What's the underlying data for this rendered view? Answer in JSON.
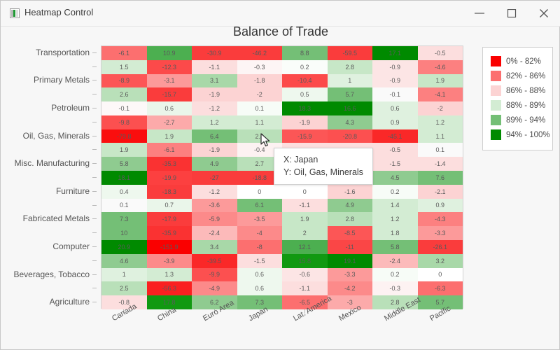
{
  "window": {
    "title": "Heatmap Control",
    "icon": "heatmap-app-icon",
    "minimize_label": "─",
    "maximize_label": "□",
    "close_label": "✕"
  },
  "chart_title": "Balance of Trade",
  "legend": {
    "items": [
      {
        "label": "0% - 82%",
        "color": "#fa0000"
      },
      {
        "label": "82% - 86%",
        "color": "#fc6f6f"
      },
      {
        "label": "86% - 88%",
        "color": "#fcd3d3"
      },
      {
        "label": "88% - 89%",
        "color": "#d3ecd3"
      },
      {
        "label": "89% - 94%",
        "color": "#74bf76"
      },
      {
        "label": "94% - 100%",
        "color": "#008a00"
      }
    ]
  },
  "tooltip": {
    "x_line": "X: Japan",
    "y_line": "Y: Oil, Gas, Minerals"
  },
  "chart_data": {
    "type": "heatmap",
    "title": "Balance of Trade",
    "xlabel": "",
    "ylabel": "",
    "grid": false,
    "legend_position": "right",
    "x_categories": [
      "Canada",
      "China",
      "Euro Area",
      "Japan",
      "Lat. America",
      "Mexico",
      "Middle East",
      "Pacific"
    ],
    "y_categories": [
      "Transportation",
      "",
      "Primary Metals",
      "",
      "Petroleum",
      "",
      "Oil, Gas, Minerals",
      "",
      "Misc. Manufacturing",
      "",
      "Furniture",
      "",
      "Fabricated Metals",
      "",
      "Computer",
      "",
      "Beverages, Tobacco",
      "",
      "Agriculture"
    ],
    "y_labeled_rows": [
      0,
      2,
      4,
      6,
      8,
      10,
      12,
      14,
      16,
      18
    ],
    "color_bins": [
      {
        "range": "0% - 82%",
        "color": "#fa0000"
      },
      {
        "range": "82% - 86%",
        "color": "#fc6f6f"
      },
      {
        "range": "86% - 88%",
        "color": "#fcd3d3"
      },
      {
        "range": "88% - 89%",
        "color": "#d3ecd3"
      },
      {
        "range": "89% - 94%",
        "color": "#74bf76"
      },
      {
        "range": "94% - 100%",
        "color": "#008a00"
      }
    ],
    "rows": [
      {
        "values": [
          -6.1,
          10.9,
          -30.9,
          -46.2,
          8.8,
          -59.5,
          17.1,
          -0.5
        ],
        "colors": [
          "#fc6f6f",
          "#4caf50",
          "#fa3c3c",
          "#fa3c3c",
          "#74bf76",
          "#fa3c3c",
          "#008a00",
          "#fcdede"
        ]
      },
      {
        "values": [
          1.5,
          -12.3,
          -1.1,
          -0.3,
          0.2,
          2.8,
          -0.9,
          -4.6
        ],
        "colors": [
          "#d3ecd3",
          "#fc4a4a",
          "#fcdede",
          "#fdf5f5",
          "#fafdfa",
          "#c7e7c7",
          "#fce5e5",
          "#fc8080"
        ]
      },
      {
        "values": [
          -8.9,
          -3.1,
          3.1,
          -1.8,
          -10.4,
          1,
          -0.9,
          1.9
        ],
        "colors": [
          "#fc5656",
          "#fc9a9a",
          "#a8d8a8",
          "#fcd3d3",
          "#fc4a4a",
          "#dff1df",
          "#fce5e5",
          "#c7e7c7"
        ]
      },
      {
        "values": [
          2.6,
          -15.7,
          -1.9,
          -2,
          0.5,
          5.7,
          -0.1,
          -4.1
        ],
        "colors": [
          "#b9e0b9",
          "#fa3c3c",
          "#fcd3d3",
          "#fcd3d3",
          "#eef8ee",
          "#74bf76",
          "#fafafa",
          "#fc8080"
        ]
      },
      {
        "values": [
          -0.1,
          0.6,
          -1.2,
          0.1,
          18.3,
          16.6,
          0.6,
          -2
        ],
        "colors": [
          "#fdf8f8",
          "#eaf6ea",
          "#fcdede",
          "#f7fcf7",
          "#008a00",
          "#008a00",
          "#dff1df",
          "#fcd3d3"
        ]
      },
      {
        "values": [
          -9.8,
          -2.7,
          1.2,
          1.1,
          -1.9,
          4.3,
          0.9,
          1.2
        ],
        "colors": [
          "#fc5050",
          "#fcaaaa",
          "#d3ecd3",
          "#d3ecd3",
          "#fcd3d3",
          "#8fcb90",
          "#dff1df",
          "#d3ecd3"
        ]
      },
      {
        "values": [
          -79.8,
          1.9,
          6.4,
          2.4,
          -15.9,
          -20.8,
          -45.1,
          1.1
        ],
        "colors": [
          "#fa0e0e",
          "#c7e7c7",
          "#74bf76",
          "#b9e0b9",
          "#fc5656",
          "#fc5050",
          "#fa2828",
          "#d3ecd3"
        ]
      },
      {
        "values": [
          1.9,
          -6.1,
          -1.9,
          -0.4,
          null,
          null,
          -0.5,
          0.1
        ],
        "colors": [
          "#c7e7c7",
          "#fc8080",
          "#fcd3d3",
          "#fdf2f2",
          "#fcdede",
          "#fcdede",
          "#fcdede",
          "#fafafa"
        ]
      },
      {
        "values": [
          5.8,
          -35.3,
          4.9,
          2.7,
          null,
          null,
          -1.5,
          -1.4
        ],
        "colors": [
          "#8fcb90",
          "#fa3232",
          "#8fcb90",
          "#b9e0b9",
          "#fcdede",
          "#fcbaba",
          "#fcdede",
          "#fcdede"
        ]
      },
      {
        "values": [
          18.1,
          -19.9,
          -27,
          -18.8,
          null,
          null,
          4.5,
          7.6
        ],
        "colors": [
          "#008a00",
          "#fc4040",
          "#fa3c3c",
          "#fa3c3c",
          "#fc8080",
          "#fcd3d3",
          "#8fcb90",
          "#74bf76"
        ]
      },
      {
        "values": [
          0.4,
          -18.3,
          -1.2,
          0,
          0,
          -1.6,
          0.2,
          -2.1
        ],
        "colors": [
          "#eef8ee",
          "#fa3c3c",
          "#fcdede",
          "#ffffff",
          "#ffffff",
          "#fcd3d3",
          "#f7fcf7",
          "#fcd3d3"
        ]
      },
      {
        "values": [
          0.1,
          0.7,
          -3.6,
          6.1,
          -1.1,
          4.9,
          1.4,
          0.9
        ],
        "colors": [
          "#fafafa",
          "#eaf6ea",
          "#fc9a9a",
          "#74bf76",
          "#fcdede",
          "#8fcb90",
          "#d3ecd3",
          "#dff1df"
        ]
      },
      {
        "values": [
          7.3,
          -17.9,
          -5.9,
          -3.5,
          1.9,
          2.8,
          1.2,
          -4.3
        ],
        "colors": [
          "#74bf76",
          "#fa3c3c",
          "#fc8a8a",
          "#fc9a9a",
          "#c7e7c7",
          "#b9e0b9",
          "#d3ecd3",
          "#fc8080"
        ]
      },
      {
        "values": [
          10,
          -35.9,
          -2.4,
          -4,
          2,
          -8.5,
          1.8,
          -3.3
        ],
        "colors": [
          "#74bf76",
          "#fa3232",
          "#fcbaba",
          "#fc8a8a",
          "#c7e7c7",
          "#fc5656",
          "#d3ecd3",
          "#fc9a9a"
        ]
      },
      {
        "values": [
          20.9,
          -151.9,
          3.4,
          -8,
          12.1,
          -11,
          5.8,
          -26.1
        ],
        "colors": [
          "#008a00",
          "#fa0000",
          "#a8d8a8",
          "#fc6f6f",
          "#4caf50",
          "#fa4646",
          "#74bf76",
          "#fa3c3c"
        ]
      },
      {
        "values": [
          4.6,
          -3.9,
          -39.5,
          -1.5,
          15.8,
          19.1,
          -2.4,
          3.2
        ],
        "colors": [
          "#8fcb90",
          "#fc8a8a",
          "#fa2828",
          "#fcdede",
          "#119911",
          "#008a00",
          "#fcbaba",
          "#a8d8a8"
        ]
      },
      {
        "values": [
          1,
          1.3,
          -9.9,
          0.6,
          -0.6,
          -3.3,
          0.2,
          0
        ],
        "colors": [
          "#dff1df",
          "#d3ecd3",
          "#fc5050",
          "#eef8ee",
          "#fce5e5",
          "#fc9a9a",
          "#f7fcf7",
          "#ffffff"
        ]
      },
      {
        "values": [
          2.5,
          -56.3,
          -4.9,
          0.6,
          -1.1,
          -4.2,
          -0.3,
          -6.3
        ],
        "colors": [
          "#b9e0b9",
          "#fa2020",
          "#fc8a8a",
          "#eef8ee",
          "#fcdede",
          "#fc8a8a",
          "#fdf2f2",
          "#fc6f6f"
        ]
      },
      {
        "values": [
          -0.8,
          17.8,
          6.2,
          7.3,
          -6.5,
          -3,
          2.8,
          5.7
        ],
        "colors": [
          "#fcdede",
          "#119911",
          "#8fcb90",
          "#74bf76",
          "#fc6f6f",
          "#fcaaaa",
          "#b9e0b9",
          "#74bf76"
        ]
      }
    ]
  }
}
